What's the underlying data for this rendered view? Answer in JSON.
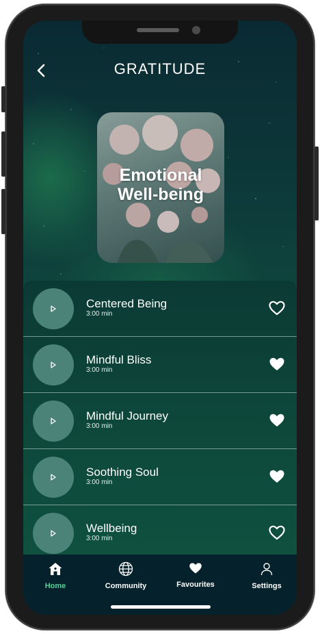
{
  "header": {
    "title": "GRATITUDE"
  },
  "cover": {
    "title_line1": "Emotional",
    "title_line2": "Well-being"
  },
  "tracks": [
    {
      "name": "Centered Being",
      "duration": "3:00 min",
      "favourite": false
    },
    {
      "name": "Mindful Bliss",
      "duration": "3:00 min",
      "favourite": true
    },
    {
      "name": "Mindful Journey",
      "duration": "3:00 min",
      "favourite": true
    },
    {
      "name": "Soothing Soul",
      "duration": "3:00 min",
      "favourite": true
    },
    {
      "name": "Wellbeing",
      "duration": "3:00 min",
      "favourite": false
    }
  ],
  "tabbar": {
    "tabs": [
      {
        "label": "Home",
        "icon": "home-icon",
        "active": true
      },
      {
        "label": "Community",
        "icon": "globe-icon",
        "active": false
      },
      {
        "label": "Favourites",
        "icon": "heart-icon",
        "active": false
      },
      {
        "label": "Settings",
        "icon": "user-icon",
        "active": false
      }
    ]
  },
  "colors": {
    "accent": "#4fd39a",
    "play_button": "#4b8378",
    "tabbar": "#05222c"
  }
}
